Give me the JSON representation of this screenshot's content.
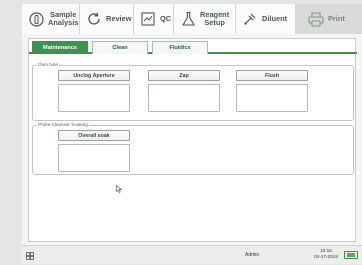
{
  "nav": {
    "sample_analysis": "Sample\nAnalysis",
    "review": "Review",
    "qc": "QC",
    "reagent_setup": "Reagent\nSetup",
    "diluent": "Diluent",
    "print": "Print"
  },
  "tabs": [
    "Maintenance",
    "Clean",
    "Fluidics"
  ],
  "active_tab": "Maintenance",
  "gem_hole": {
    "title": "Gem hole",
    "buttons": [
      "Unclog Aperture",
      "Zap",
      "Flush"
    ]
  },
  "probe_cleanser": {
    "title": "Probe Cleanser Soaking",
    "button": "Overall soak"
  },
  "status": {
    "user": "Admin",
    "time": "10:15",
    "date": "04-17-2019"
  },
  "colors": {
    "accent": "#3f9152",
    "nav_text": "#4b5a4f"
  },
  "icons": {
    "sample_analysis": "sample-analysis-icon",
    "review": "review-icon",
    "qc": "qc-icon",
    "reagent_setup": "reagent-flask-icon",
    "diluent": "diluent-icon",
    "print": "printer-icon",
    "menu": "grid-menu-icon",
    "battery": "battery-icon",
    "cursor": "mouse-cursor-icon"
  }
}
